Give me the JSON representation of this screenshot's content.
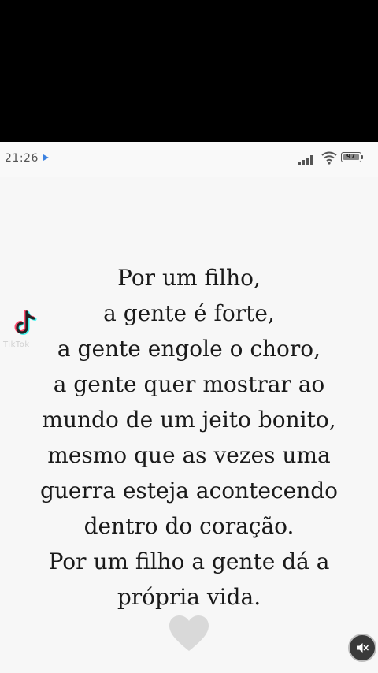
{
  "status_bar": {
    "time": "21:26",
    "battery_level": "97"
  },
  "quote": {
    "lines": [
      "Por um filho,",
      "a gente é forte,",
      "a gente engole o choro,",
      "a gente quer mostrar ao",
      "mundo de um jeito bonito,",
      "mesmo que as vezes uma",
      "guerra esteja acontecendo",
      "dentro do coração.",
      "Por um filho a gente dá a",
      "própria vida."
    ]
  },
  "watermark": {
    "text": "TikTok"
  },
  "icons": {
    "play": "play-icon",
    "signal": "signal-icon",
    "wifi": "wifi-icon",
    "battery": "battery-icon",
    "tiktok": "tiktok-logo-icon",
    "heart": "heart-icon",
    "mute": "mute-icon"
  },
  "colors": {
    "background": "#f7f7f7",
    "text": "#1a1a1a",
    "accent_blue": "#3c82e0",
    "heart": "#d9d9d9"
  }
}
